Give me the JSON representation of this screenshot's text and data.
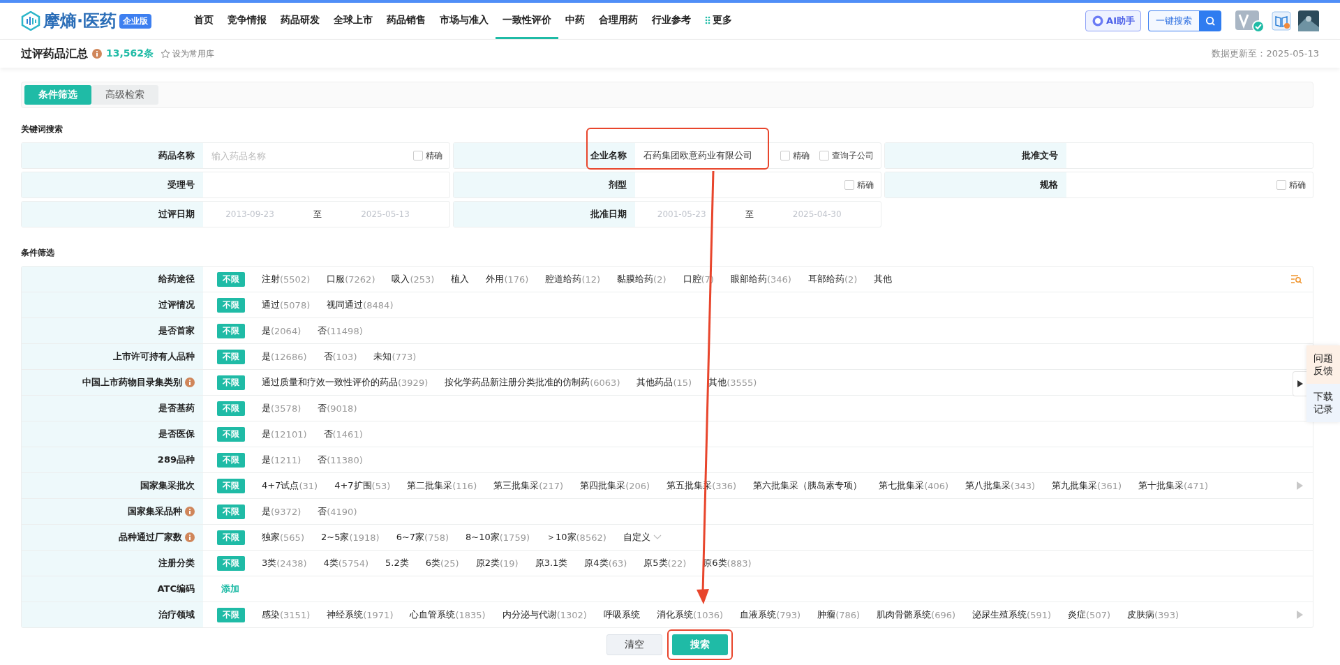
{
  "header": {
    "logo_text": "摩熵·医药",
    "edition_badge": "企业版",
    "nav": [
      {
        "label": "首页",
        "selected": false
      },
      {
        "label": "竞争情报",
        "selected": false
      },
      {
        "label": "药品研发",
        "selected": false
      },
      {
        "label": "全球上市",
        "selected": false
      },
      {
        "label": "药品销售",
        "selected": false
      },
      {
        "label": "市场与准入",
        "selected": false
      },
      {
        "label": "一致性评价",
        "selected": true
      },
      {
        "label": "中药",
        "selected": false
      },
      {
        "label": "合理用药",
        "selected": false
      },
      {
        "label": "行业参考",
        "selected": false
      },
      {
        "label": "更多",
        "selected": false
      }
    ],
    "ai_button": "AI助手",
    "search_button": "一键搜索"
  },
  "subheader": {
    "title": "过评药品汇总",
    "count": "13,562条",
    "favorite": "设为常用库",
    "updated": "数据更新至：2025-05-13"
  },
  "tabs": [
    {
      "label": "条件筛选",
      "selected": true
    },
    {
      "label": "高级检索",
      "selected": false
    }
  ],
  "keyword_search": {
    "title": "关键词搜索",
    "fields": [
      {
        "kind": "text",
        "label": "药品名称",
        "placeholder": "输入药品名称",
        "checkboxes": [
          {
            "label": "精确",
            "checked": false
          }
        ]
      },
      {
        "kind": "text",
        "label": "企业名称",
        "value": "石药集团欧意药业有限公司",
        "highlighted": true,
        "checkboxes": [
          {
            "label": "精确",
            "checked": false
          },
          {
            "label": "查询子公司",
            "checked": false
          }
        ]
      },
      {
        "kind": "text",
        "label": "批准文号"
      },
      {
        "kind": "text",
        "label": "受理号"
      },
      {
        "kind": "text",
        "label": "剂型",
        "checkboxes": [
          {
            "label": "精确",
            "checked": false
          }
        ]
      },
      {
        "kind": "text",
        "label": "规格",
        "checkboxes": [
          {
            "label": "精确",
            "checked": false
          }
        ]
      },
      {
        "kind": "date",
        "label": "过评日期",
        "from": "2013-09-23",
        "separator": "至",
        "to": "2025-05-13"
      },
      {
        "kind": "date",
        "label": "批准日期",
        "from": "2001-05-23",
        "separator": "至",
        "to": "2025-04-30"
      }
    ]
  },
  "conditions": {
    "title": "条件筛选",
    "rows": [
      {
        "label": "给药途径",
        "any": {
          "label": "不限",
          "selected": true
        },
        "options": [
          {
            "name": "注射",
            "count": "(5502)"
          },
          {
            "name": "口服",
            "count": "(7262)"
          },
          {
            "name": "吸入",
            "count": "(253)"
          },
          {
            "name": "植入"
          },
          {
            "name": "外用",
            "count": "(176)"
          },
          {
            "name": "腔道给药",
            "count": "(12)"
          },
          {
            "name": "黏膜给药",
            "count": "(2)"
          },
          {
            "name": "口腔",
            "count": "(7)"
          },
          {
            "name": "眼部给药",
            "count": "(346)"
          },
          {
            "name": "耳部给药",
            "count": "(2)"
          },
          {
            "name": "其他"
          }
        ],
        "filter_icon": true
      },
      {
        "label": "过评情况",
        "any": {
          "label": "不限",
          "selected": true
        },
        "options": [
          {
            "name": "通过",
            "count": "(5078)"
          },
          {
            "name": "视同通过",
            "count": "(8484)"
          }
        ]
      },
      {
        "label": "是否首家",
        "any": {
          "label": "不限",
          "selected": true
        },
        "options": [
          {
            "name": "是",
            "count": "(2064)"
          },
          {
            "name": "否",
            "count": "(11498)"
          }
        ]
      },
      {
        "label": "上市许可持有人品种",
        "any": {
          "label": "不限",
          "selected": true
        },
        "options": [
          {
            "name": "是",
            "count": "(12686)"
          },
          {
            "name": "否",
            "count": "(103)"
          },
          {
            "name": "未知",
            "count": "(773)"
          }
        ]
      },
      {
        "label": "中国上市药物目录集类别",
        "info": true,
        "any": {
          "label": "不限",
          "selected": true
        },
        "options": [
          {
            "name": "通过质量和疗效一致性评价的药品",
            "count": "(3929)"
          },
          {
            "name": "按化学药品新注册分类批准的仿制药",
            "count": "(6063)"
          },
          {
            "name": "其他药品",
            "count": "(15)"
          },
          {
            "name": "其他",
            "count": "(3555)"
          }
        ]
      },
      {
        "label": "是否基药",
        "any": {
          "label": "不限",
          "selected": true
        },
        "options": [
          {
            "name": "是",
            "count": "(3578)"
          },
          {
            "name": "否",
            "count": "(9018)"
          }
        ]
      },
      {
        "label": "是否医保",
        "any": {
          "label": "不限",
          "selected": true
        },
        "options": [
          {
            "name": "是",
            "count": "(12101)"
          },
          {
            "name": "否",
            "count": "(1461)"
          }
        ]
      },
      {
        "label": "289品种",
        "any": {
          "label": "不限",
          "selected": true
        },
        "options": [
          {
            "name": "是",
            "count": "(1211)"
          },
          {
            "name": "否",
            "count": "(11380)"
          }
        ]
      },
      {
        "label": "国家集采批次",
        "any": {
          "label": "不限",
          "selected": true
        },
        "options": [
          {
            "name": "4+7试点",
            "count": "(31)"
          },
          {
            "name": "4+7扩围",
            "count": "(53)"
          },
          {
            "name": "第二批集采",
            "count": "(116)"
          },
          {
            "name": "第三批集采",
            "count": "(217)"
          },
          {
            "name": "第四批集采",
            "count": "(206)"
          },
          {
            "name": "第五批集采",
            "count": "(336)"
          },
          {
            "name": "第六批集采（胰岛素专项）"
          },
          {
            "name": "第七批集采",
            "count": "(406)"
          },
          {
            "name": "第八批集采",
            "count": "(343)"
          },
          {
            "name": "第九批集采",
            "count": "(361)"
          },
          {
            "name": "第十批集采",
            "count": "(471)"
          }
        ],
        "more": true
      },
      {
        "label": "国家集采品种",
        "info": true,
        "any": {
          "label": "不限",
          "selected": true
        },
        "options": [
          {
            "name": "是",
            "count": "(9372)"
          },
          {
            "name": "否",
            "count": "(4190)"
          }
        ]
      },
      {
        "label": "品种通过厂家数",
        "info": true,
        "any": {
          "label": "不限",
          "selected": true
        },
        "options": [
          {
            "name": "独家",
            "count": "(565)"
          },
          {
            "name": "2~5家",
            "count": "(1918)"
          },
          {
            "name": "6~7家",
            "count": "(758)"
          },
          {
            "name": "8~10家",
            "count": "(1759)"
          },
          {
            "name": "＞10家",
            "count": "(8562)"
          }
        ],
        "custom": "自定义"
      },
      {
        "label": "注册分类",
        "any": {
          "label": "不限",
          "selected": true
        },
        "options": [
          {
            "name": "3类",
            "count": "(2438)"
          },
          {
            "name": "4类",
            "count": "(5754)"
          },
          {
            "name": "5.2类"
          },
          {
            "name": "6类",
            "count": "(25)"
          },
          {
            "name": "原2类",
            "count": "(19)"
          },
          {
            "name": "原3.1类"
          },
          {
            "name": "原4类",
            "count": "(63)"
          },
          {
            "name": "原5类",
            "count": "(22)"
          },
          {
            "name": "原6类",
            "count": "(883)"
          }
        ]
      },
      {
        "label": "ATC编码",
        "add": "添加"
      },
      {
        "label": "治疗领域",
        "any": {
          "label": "不限",
          "selected": true
        },
        "options": [
          {
            "name": "感染",
            "count": "(3151)"
          },
          {
            "name": "神经系统",
            "count": "(1971)"
          },
          {
            "name": "心血管系统",
            "count": "(1835)"
          },
          {
            "name": "内分泌与代谢",
            "count": "(1302)"
          },
          {
            "name": "呼吸系统"
          },
          {
            "name": "消化系统",
            "count": "(1036)"
          },
          {
            "name": "血液系统",
            "count": "(793)"
          },
          {
            "name": "肿瘤",
            "count": "(786)"
          },
          {
            "name": "肌肉骨骼系统",
            "count": "(696)"
          },
          {
            "name": "泌尿生殖系统",
            "count": "(591)"
          },
          {
            "name": "炎症",
            "count": "(507)"
          },
          {
            "name": "皮肤病",
            "count": "(393)"
          }
        ],
        "more": true
      }
    ]
  },
  "actions": [
    {
      "label": "清空",
      "kind": "secondary"
    },
    {
      "label": "搜索",
      "kind": "primary",
      "highlighted": true
    }
  ],
  "side_tabs": [
    {
      "label": "问题反馈",
      "kind": "feedback"
    },
    {
      "label": "下载记录",
      "kind": "download"
    }
  ]
}
